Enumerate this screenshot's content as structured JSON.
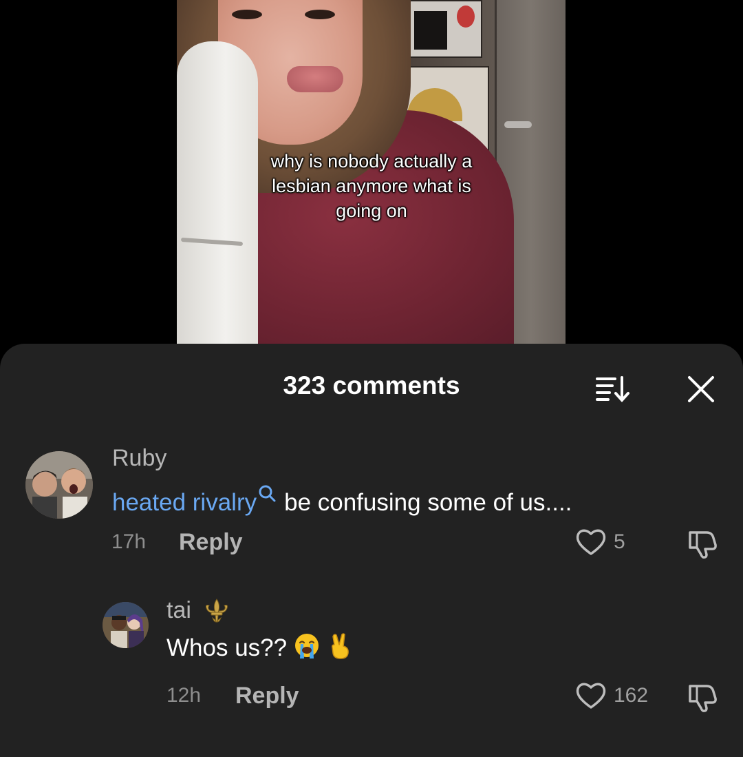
{
  "video": {
    "caption": "why is nobody actually a lesbian anymore what is going on"
  },
  "comments_panel": {
    "title": "323 comments",
    "icons": {
      "sort": "sort-descending-icon",
      "close": "close-icon"
    }
  },
  "comments": [
    {
      "username": "Ruby",
      "tag_link": "heated rivalry",
      "text": "be confusing some of us....",
      "time": "17h",
      "reply_label": "Reply",
      "likes": "5"
    },
    {
      "username": "tai",
      "username_badge": "fleur-de-lis-icon",
      "text": "Whos us??",
      "emojis": [
        "loudly-crying-face",
        "victory-hand"
      ],
      "time": "12h",
      "reply_label": "Reply",
      "likes": "162"
    }
  ],
  "colors": {
    "sheet_bg": "#222222",
    "link": "#6aa8f2",
    "muted_text": "#8e8e8e"
  }
}
